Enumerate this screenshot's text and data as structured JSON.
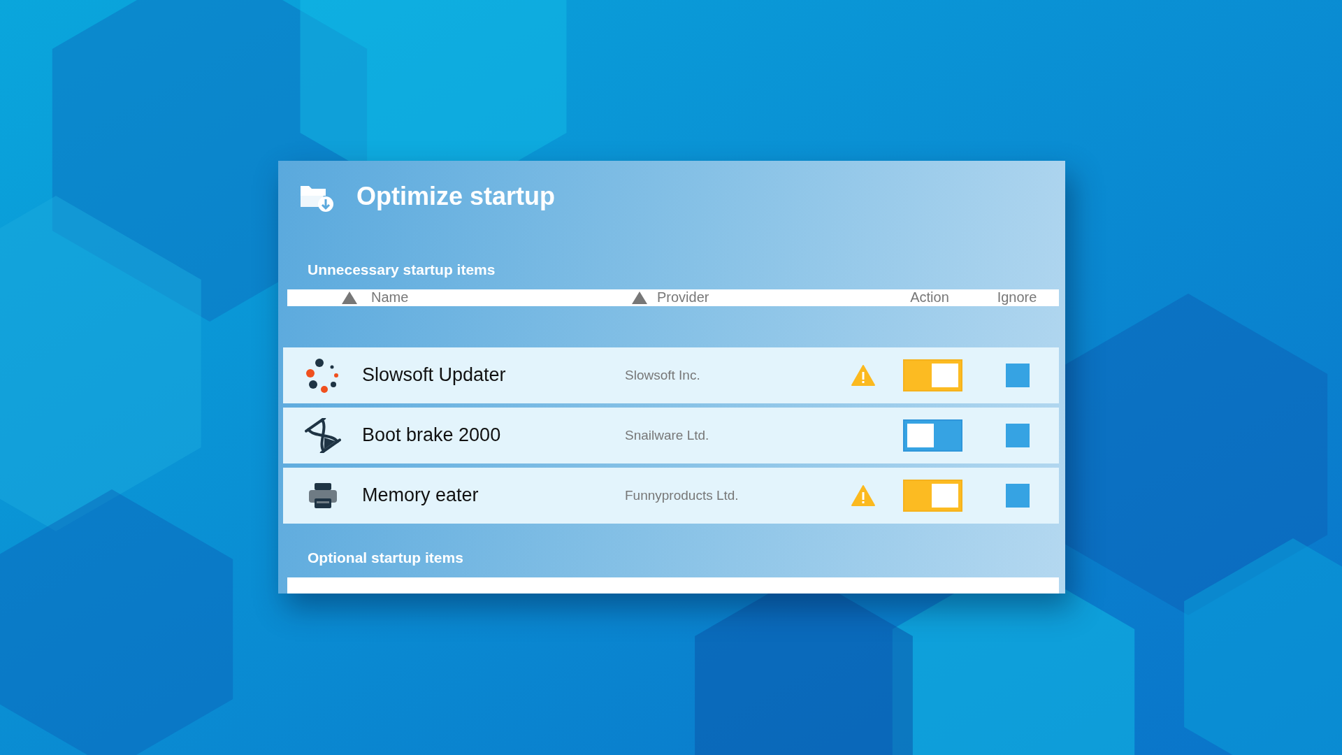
{
  "window": {
    "title": "Optimize startup"
  },
  "sections": [
    {
      "title": "Unnecessary startup items",
      "columns": {
        "name": "Name",
        "provider": "Provider",
        "action": "Action",
        "ignore": "Ignore"
      },
      "rows": [
        {
          "kind": "dots",
          "name": "Slowsoft Updater",
          "provider": "Slowsoft Inc.",
          "warning": true,
          "on": true,
          "ignored": false
        },
        {
          "kind": "hourglass",
          "name": "Boot brake 2000",
          "provider": "Snailware Ltd.",
          "warning": false,
          "on": false,
          "ignored": false
        },
        {
          "kind": "printer",
          "name": "Memory eater",
          "provider": "Funnyproducts Ltd.",
          "warning": true,
          "on": true,
          "ignored": false
        }
      ]
    },
    {
      "title": "Optional startup items"
    }
  ]
}
